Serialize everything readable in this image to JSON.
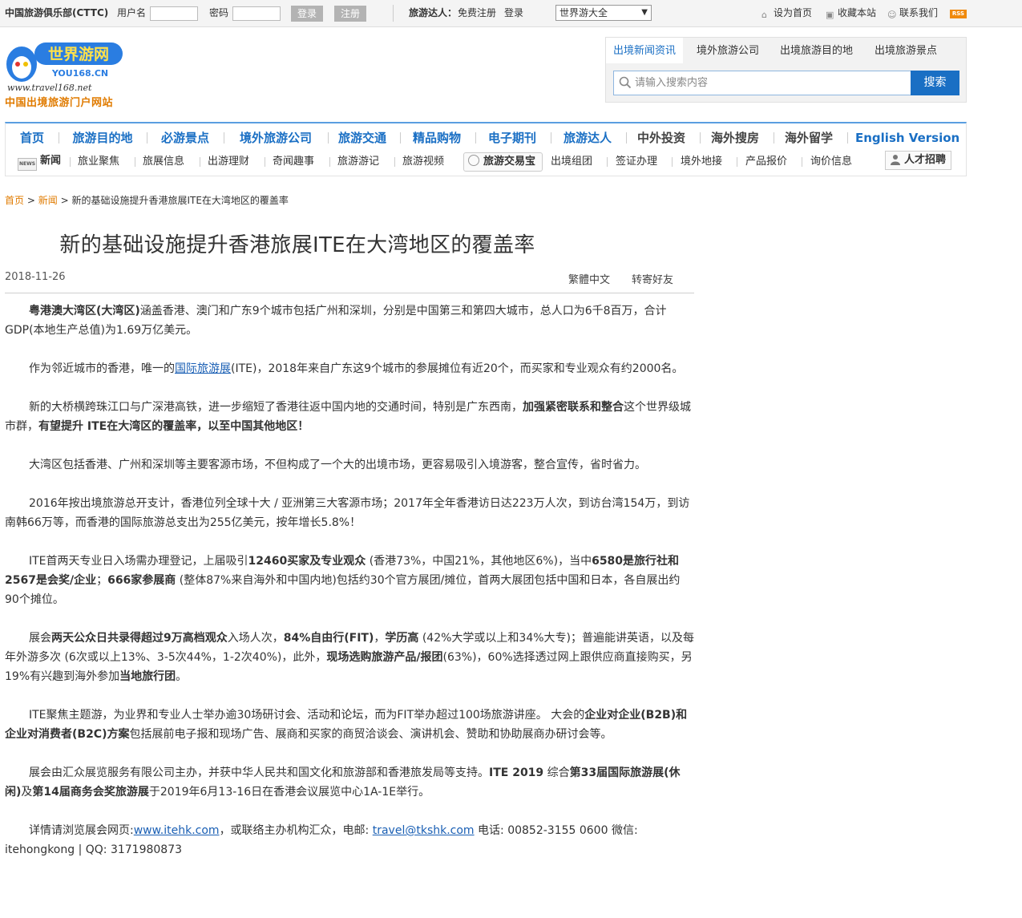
{
  "topbar": {
    "club": "中国旅游俱乐部(CTTC)",
    "username_label": "用户名",
    "password_label": "密码",
    "login": "登录",
    "register": "注册",
    "talent_label": "旅游达人：",
    "free_register": "免费注册",
    "talent_login": "登录",
    "site_select": "世界游大全",
    "set_homepage": "设为首页",
    "add_favorite": "收藏本站",
    "contact": "联系我们",
    "rss": "RSS"
  },
  "logo": {
    "title": "世界游网",
    "domain_cn": "YOU168.CN",
    "url": "www.travel168.net",
    "tagline": "中国出境旅游门户网站"
  },
  "search": {
    "tabs": [
      "出境新闻资讯",
      "境外旅游公司",
      "出境旅游目的地",
      "出境旅游景点"
    ],
    "placeholder": "请输入搜索内容",
    "button": "搜索"
  },
  "nav": {
    "main": [
      "首页",
      "旅游目的地",
      "必游景点",
      "境外旅游公司",
      "旅游交通",
      "精品购物",
      "电子期刊",
      "旅游达人",
      "中外投资",
      "海外搜房",
      "海外留学",
      "English Version"
    ],
    "news_tag": "新闻",
    "news_badge": "NEWS",
    "news_sub": [
      "旅业聚焦",
      "旅展信息",
      "出游理财",
      "奇闻趣事",
      "旅游游记",
      "旅游视频"
    ],
    "trade_tag": "旅游交易宝",
    "trade_sub": [
      "出境组团",
      "签证办理",
      "境外地接",
      "产品报价",
      "询价信息"
    ],
    "jobs_tag": "人才招聘"
  },
  "breadcrumb": {
    "home": "首页",
    "sep1": ">",
    "news": "新闻",
    "sep2": ">",
    "current": "新的基础设施提升香港旅展ITE在大湾地区的覆盖率"
  },
  "article": {
    "title": "新的基础设施提升香港旅展ITE在大湾地区的覆盖率",
    "date": "2018-11-26",
    "traditional": "繁體中文",
    "forward": "转寄好友",
    "p1": {
      "b1": "粤港澳大湾区(大湾区)",
      "t1": "涵盖香港、澳门和广东9个城市包括广州和深圳，分别是中国第三和第四大城市，总人口为6千8百万，合计GDP(本地生产总值)为1.69万亿美元。"
    },
    "p2": {
      "t1": "作为邻近城市的香港，唯一的",
      "link": "国际旅游展",
      "t2": "(ITE)，2018年来自广东这9个城市的参展摊位有近20个，而买家和专业观众有约2000名。"
    },
    "p3": {
      "t1": "新的大桥横跨珠江口与广深港高铁，进一步缩短了香港往返中国内地的交通时间，特别是广东西南，",
      "b1": "加强紧密联系和整合",
      "t2": "这个世界级城市群，",
      "b2": "有望提升 ITE在大湾区的覆盖率，以至中国其他地区！"
    },
    "p4": "大湾区包括香港、广州和深圳等主要客源市场，不但构成了一个大的出境市场，更容易吸引入境游客，整合宣传，省时省力。",
    "p5": "2016年按出境旅游总开支计，香港位列全球十大 / 亚洲第三大客源市场；2017年全年香港访日达223万人次，到访台湾154万，到访南韩66万等，而香港的国际旅游总支出为255亿美元，按年增长5.8%！",
    "p6": {
      "t1": "ITE首两天专业日入场需办理登记，上届吸引",
      "b1": "12460买家及专业观众",
      "t2": " (香港73%，中国21%，其他地区6%)，当中",
      "b2": "6580是旅行社和2567是会奖/企业",
      "t3": "；",
      "b3": "666家参展商",
      "t4": " (整体87%来自海外和中国内地)包括约30个官方展团/摊位，首两大展团包括中国和日本，各自展出约90个摊位。"
    },
    "p7": {
      "t1": "展会",
      "b1": "两天公众日共录得超过9万高档观众",
      "t2": "入场人次，",
      "b2": "84%自由行(FIT)",
      "t3": "，",
      "b3": "学历高",
      "t4": " (42%大学或以上和34%大专)；普遍能讲英语，以及每年外游多次 (6次或以上13%、3-5次44%，1-2次40%)，此外，",
      "b4": "现场选购旅游产品/报团",
      "t5": "(63%)，60%选择透过网上跟供应商直接购买，另19%有兴趣到海外参加",
      "b5": "当地旅行团",
      "t6": "。"
    },
    "p8": {
      "t1": "ITE聚焦主题游，为业界和专业人士举办逾30场研讨会、活动和论坛，而为FIT举办超过100场旅游讲座。 大会的",
      "b1": "企业对企业(B2B)和企业对消费者(B2C)方案",
      "t2": "包括展前电子报和现场广告、展商和买家的商贸洽谈会、演讲机会、赞助和协助展商办研讨会等。"
    },
    "p9": {
      "t1": "展会由汇众展览服务有限公司主办，并获中华人民共和国文化和旅游部和香港旅发局等支持。",
      "b1": "ITE 2019",
      "t2": " 综合",
      "b2": "第33届国际旅游展(休闲)",
      "t3": "及",
      "b3": "第14届商务会奖旅游展",
      "t4": "于2019年6月13-16日在香港会议展览中心1A-1E举行。"
    },
    "p10": {
      "t1": "详情请浏览展会网页:",
      "link1": "www.itehk.com",
      "t2": "，或联络主办机构汇众，电邮: ",
      "link2": "travel@tkshk.com",
      "t3": " 电话: 00852-3155 0600 微信: itehongkong | QQ: 3171980873"
    }
  },
  "colors": {
    "brand_blue": "#1a6fc4",
    "breadcrumb_orange": "#e07b00",
    "link_blue": "#1a5fb4"
  }
}
